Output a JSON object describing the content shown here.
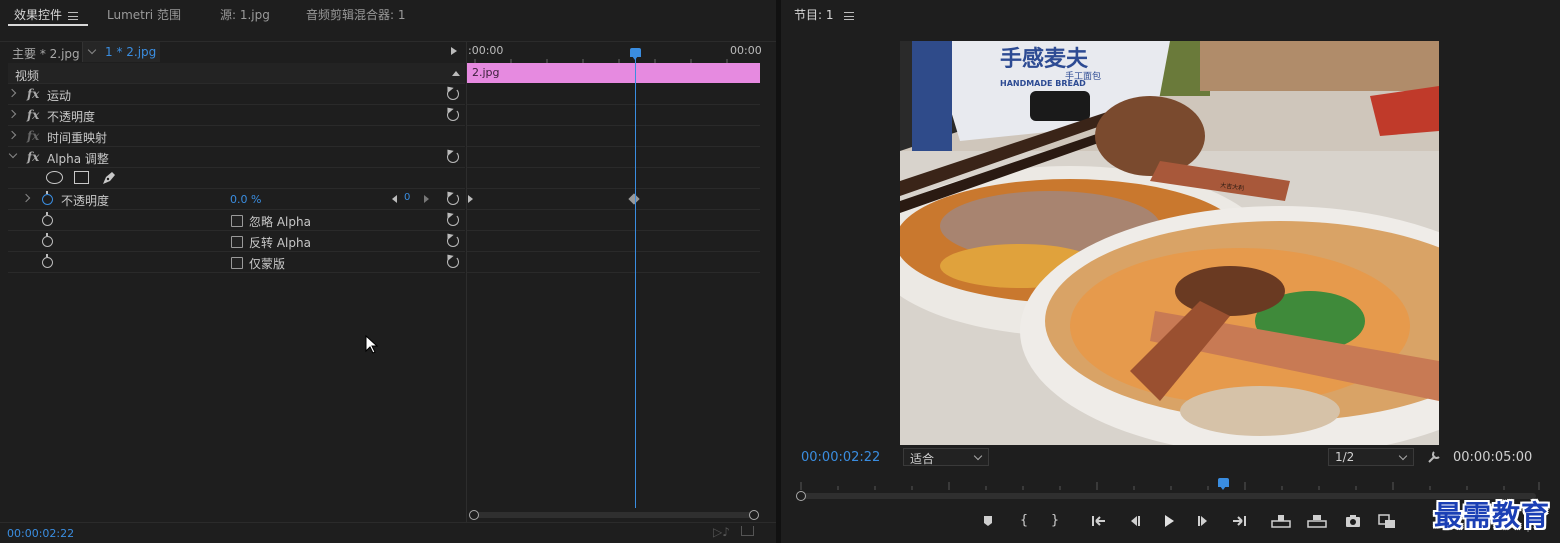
{
  "left_panel": {
    "tabs": [
      {
        "label": "效果控件"
      },
      {
        "label": "Lumetri 范围"
      },
      {
        "label": "源: 1.jpg"
      },
      {
        "label": "音频剪辑混合器: 1"
      }
    ],
    "clip_header": {
      "master_label": "主要 * 2.jpg",
      "sequence_label": "1 * 2.jpg"
    },
    "section_label": "视频",
    "effects": [
      {
        "label": "运动"
      },
      {
        "label": "不透明度"
      },
      {
        "label": "时间重映射"
      },
      {
        "label": "Alpha 调整"
      }
    ],
    "alpha_props": {
      "opacity_label": "不透明度",
      "opacity_value": "0.0 %",
      "keyframe_index": "0",
      "checkboxes": [
        {
          "label": "忽略 Alpha",
          "checked": false
        },
        {
          "label": "反转 Alpha",
          "checked": false
        },
        {
          "label": "仅蒙版",
          "checked": false
        }
      ]
    },
    "timeline": {
      "start_time": ":00:00",
      "end_time": "00:00",
      "clip_name": "2.jpg",
      "clip_color": "#e68ae0"
    },
    "current_time": "00:00:02:22"
  },
  "program_monitor": {
    "title": "节目: 1",
    "current_time": "00:00:02:22",
    "fit_option": "适合",
    "resolution": "1/2",
    "duration": "00:00:05:00",
    "image_text": {
      "line1": "手感麦夫",
      "line2": "HANDMADE BREAD",
      "line3": "手工面包",
      "spoon_text": "大吉大利"
    }
  },
  "watermark": "最需教育",
  "colors": {
    "accent": "#3a8de0",
    "playhead": "#3a8de0",
    "clip": "#e68ae0"
  }
}
